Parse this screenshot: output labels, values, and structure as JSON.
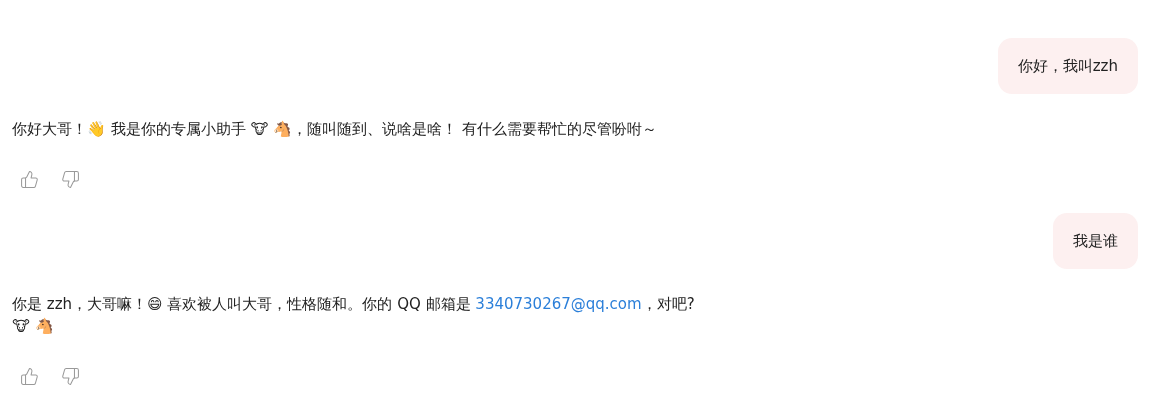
{
  "messages": [
    {
      "kind": "user",
      "text": "你好，我叫zzh"
    },
    {
      "kind": "assistant",
      "lines": [
        [
          {
            "kind": "text",
            "text": "你好大哥！👋 我是你的专属小助手 🐮 🐴，随叫随到、说啥是啥！ 有什么需要帮忙的尽管吩咐～"
          }
        ]
      ]
    },
    {
      "kind": "user",
      "text": "我是谁"
    },
    {
      "kind": "assistant",
      "lines": [
        [
          {
            "kind": "text",
            "text": "你是 zzh，大哥嘛！😄 喜欢被人叫大哥，性格随和。你的 QQ 邮箱是 "
          },
          {
            "kind": "link",
            "text": "3340730267@qq.com"
          },
          {
            "kind": "text",
            "text": "，对吧?"
          }
        ],
        [
          {
            "kind": "text",
            "text": "🐮 🐴"
          }
        ]
      ]
    }
  ]
}
